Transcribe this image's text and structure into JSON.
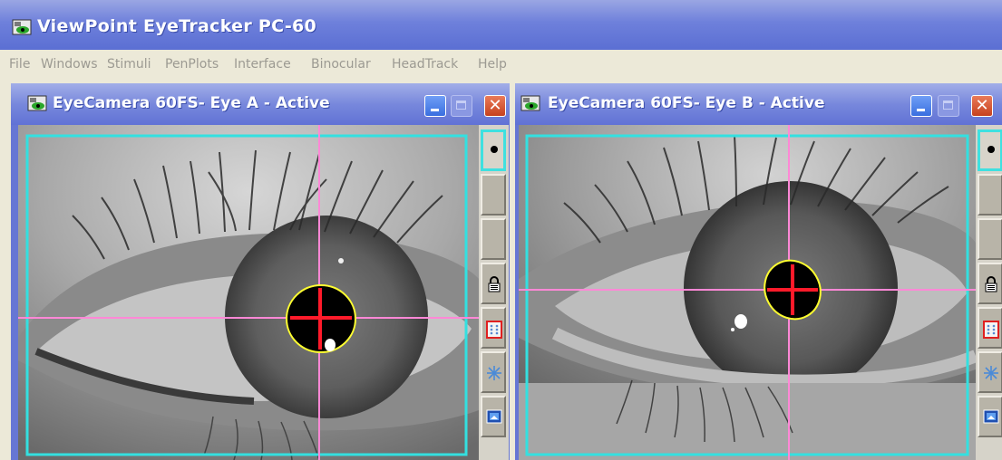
{
  "app": {
    "title": "ViewPoint EyeTracker PC-60",
    "icon": "eyetracker-app-icon"
  },
  "menu": {
    "items": [
      "File",
      "Windows",
      "Stimuli",
      "PenPlots",
      "Interface",
      "Binocular",
      "HeadTrack",
      "Help"
    ]
  },
  "windows": [
    {
      "title": "EyeCamera 60FS- Eye A - Active",
      "controls": {
        "close": "✕"
      }
    },
    {
      "title": "EyeCamera 60FS- Eye B - Active",
      "controls": {
        "close": "✕"
      }
    }
  ],
  "tools": [
    "pupil-dot-icon",
    "blank-tool",
    "blank-tool",
    "lock-icon",
    "grid-icon",
    "freeze-icon",
    "image-icon"
  ],
  "colors": {
    "roi_box": "#33e0e0",
    "crosshair": "#ff88d6",
    "pupil_outline": "#ffff30",
    "pupil_center": "#ff1a2a",
    "titlebar": "#6f80d8"
  }
}
